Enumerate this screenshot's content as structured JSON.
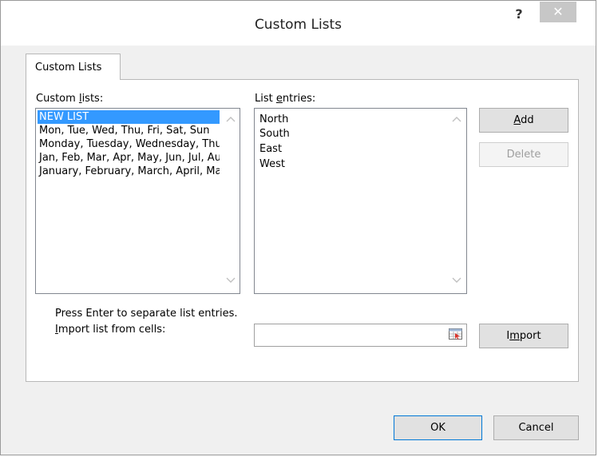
{
  "window": {
    "title": "Custom Lists",
    "help_label": "?",
    "close_label": "✕"
  },
  "tab": {
    "label": "Custom Lists"
  },
  "custom_lists": {
    "label": "Custom lists:",
    "items": [
      "NEW LIST",
      "Mon, Tue, Wed, Thu, Fri, Sat, Sun",
      "Monday, Tuesday, Wednesday, Thursday, Friday, Saturday, Sunday",
      "Jan, Feb, Mar, Apr, May, Jun, Jul, Aug, Sep, Oct, Nov, Dec",
      "January, February, March, April, May, June, July, August, September, October, November, December"
    ],
    "selected_index": 0
  },
  "list_entries": {
    "label": "List entries:",
    "items": [
      "North",
      "South",
      "East",
      "West"
    ]
  },
  "buttons": {
    "add": "Add",
    "delete": "Delete",
    "import": "Import",
    "ok": "OK",
    "cancel": "Cancel"
  },
  "hint": "Press Enter to separate list entries.",
  "import_field": {
    "label": "Import list from cells:",
    "value": ""
  },
  "icons": {
    "scroll_up": "chevron-up-icon",
    "scroll_down": "chevron-down-icon",
    "collapse_dialog": "collapse-dialog-icon",
    "help": "help-icon",
    "close": "close-icon"
  },
  "colors": {
    "selection": "#3399ff",
    "close_button": "#c7c7c7",
    "default_button_border": "#0078d7"
  }
}
